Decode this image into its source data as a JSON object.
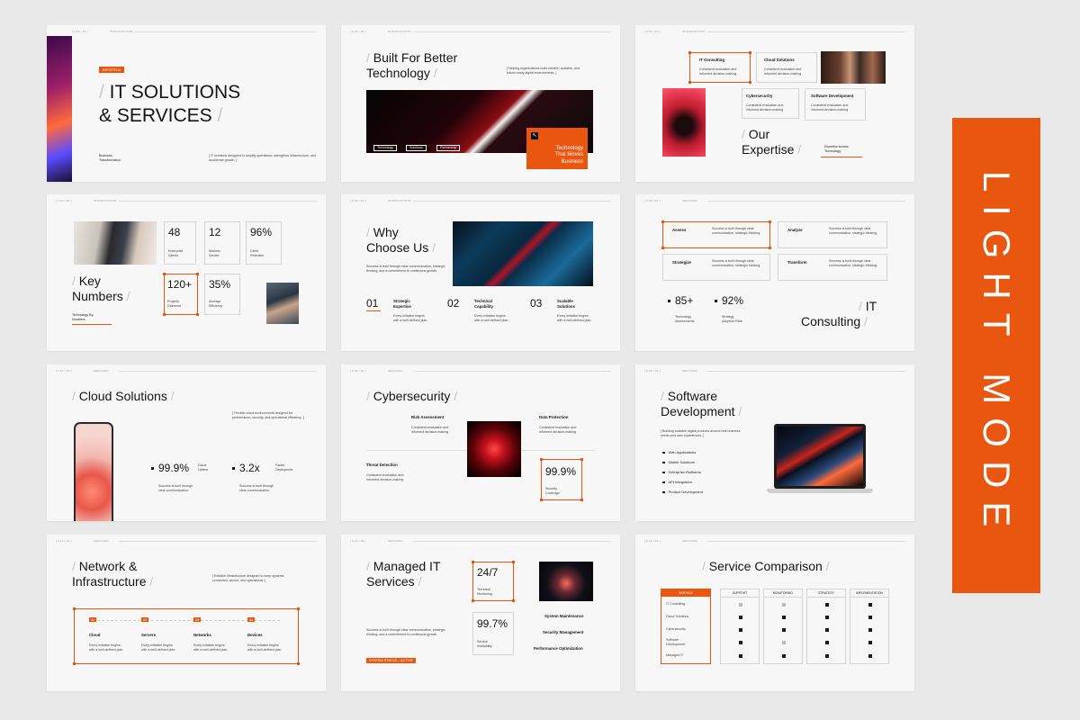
{
  "light_mode_label": "LIGHT MODE",
  "colors": {
    "accent": "#e8560f",
    "background": "#e9e9e9",
    "slide": "#f7f7f7",
    "text": "#141414"
  },
  "slides": {
    "s1": {
      "num": "[ 0.01 / 20 ]",
      "section": "INTRODUCTION",
      "badge": "INFOTECH",
      "title1": "IT SOLUTIONS",
      "title2": "& SERVICES",
      "sub_label": "Business\nTransformation",
      "desc": "[ IT solutions designed to amplify operations, strengthen infrastructure, and accelerate growth. ]"
    },
    "s2": {
      "num": "[ 0.02 / 20 ]",
      "section": "INTRODUCTION",
      "title1": "Built For Better",
      "title2": "Technology",
      "desc": "[ Helping organizations build reliable, scalable, and future-ready digital environments. ]",
      "tags": [
        "Technology",
        "Solutions",
        "Partnership"
      ],
      "overlay": "Technology\nThat Moves\nBusiness"
    },
    "s3": {
      "num": "[ 0.03 / 20 ]",
      "section": "INTRODUCTION",
      "cards": [
        {
          "label": "IT Consulting",
          "desc": "Consistent evaluation and informed decision-making"
        },
        {
          "label": "Cloud Solutions",
          "desc": "Consistent evaluation and informed decision-making"
        },
        {
          "label": "Cybersecurity",
          "desc": "Consistent evaluation and informed decision-making"
        },
        {
          "label": "Software Development",
          "desc": "Consistent evaluation and informed decision-making"
        }
      ],
      "title1": "Our",
      "title2": "Expertise",
      "tag": "Expertise Across\nTechnology"
    },
    "s4": {
      "num": "[ 0.04 / 20 ]",
      "section": "INTRODUCTION",
      "stats": [
        {
          "value": "48",
          "label": "Enterprise\nClients"
        },
        {
          "value": "12",
          "label": "Markets\nServed"
        },
        {
          "value": "96%",
          "label": "Client\nRetention"
        },
        {
          "value": "120+",
          "label": "Projects\nDelivered"
        },
        {
          "value": "35%",
          "label": "Average\nEfficiency"
        }
      ],
      "title1": "Key",
      "title2": "Numbers",
      "tag": "Technology By\nNumbers"
    },
    "s5": {
      "num": "[ 0.05 / 20 ]",
      "section": "INTRODUCTION",
      "title1": "Why",
      "title2": "Choose Us",
      "desc": "Success is built through clear communication, strategic thinking, and a commitment to continuous growth.",
      "items": [
        {
          "n": "01",
          "label": "Strategic\nExpertise",
          "desc": "Every initiative begins\nwith a well-defined plan."
        },
        {
          "n": "02",
          "label": "Technical\nCapability",
          "desc": "Every initiative begins\nwith a well-defined plan."
        },
        {
          "n": "03",
          "label": "Scalable\nSolutions",
          "desc": "Every initiative begins\nwith a well-defined plan."
        }
      ]
    },
    "s6": {
      "num": "[ 0.06 / 20 ]",
      "section": "SERVICES",
      "steps": [
        {
          "label": "Assess",
          "desc": "Success is built through clear communication, strategic thinking."
        },
        {
          "label": "Analyze",
          "desc": "Success is built through clear communication, strategic thinking."
        },
        {
          "label": "Strategize",
          "desc": "Success is built through clear communication, strategic thinking."
        },
        {
          "label": "Transform",
          "desc": "Success is built through clear communication, strategic thinking."
        }
      ],
      "stats": [
        {
          "value": "85+",
          "label": "Technology\nAssessments"
        },
        {
          "value": "92%",
          "label": "Strategy\nAdoption Rate"
        }
      ],
      "title1": "IT",
      "title2": "Consulting"
    },
    "s7": {
      "num": "[ 0.07 / 20 ]",
      "section": "SERVICES",
      "title": "Cloud Solutions",
      "desc": "[ Flexible cloud environments designed for performance, security, and operational efficiency. ]",
      "stats": [
        {
          "value": "99.9%",
          "label": "Cloud\nUptime",
          "desc": "Success is built through\nclear communication."
        },
        {
          "value": "3.2x",
          "label": "Faster\nDeployment",
          "desc": "Success is built through\nclear communication."
        }
      ]
    },
    "s8": {
      "num": "[ 0.08 / 20 ]",
      "section": "SERVICES",
      "title": "Cybersecurity",
      "items": [
        {
          "label": "Risk Assessment",
          "desc": "Consistent evaluation and\ninformed decision-making"
        },
        {
          "label": "Data Protection",
          "desc": "Consistent evaluation and\ninformed decision-making"
        },
        {
          "label": "Threat Detection",
          "desc": "Consistent evaluation and\ninformed decision-making"
        }
      ],
      "stat_value": "99.9%",
      "stat_label": "Security\nCoverage"
    },
    "s9": {
      "num": "[ 0.09 / 20 ]",
      "section": "SERVICES",
      "title1": "Software",
      "title2": "Development",
      "desc": "[ Building scalable digital products around real business needs and user experiences. ]",
      "list": [
        "Web Applications",
        "Mobile Solutions",
        "Enterprise Platforms",
        "API Integration",
        "Product Development"
      ]
    },
    "s10": {
      "num": "[ 0.10 / 20 ]",
      "section": "SERVICES",
      "title1": "Network &",
      "title2": "Infrastructure",
      "desc": "[ Reliable infrastructure designed to keep systems connected, secure, and operational. ]",
      "items": [
        {
          "n": "01",
          "label": "Cloud",
          "desc": "Every initiative begins\nwith a well-defined plan."
        },
        {
          "n": "02",
          "label": "Servers",
          "desc": "Every initiative begins\nwith a well-defined plan."
        },
        {
          "n": "03",
          "label": "Networks",
          "desc": "Every initiative begins\nwith a well-defined plan."
        },
        {
          "n": "04",
          "label": "Devices",
          "desc": "Every initiative begins\nwith a well-defined plan."
        }
      ]
    },
    "s11": {
      "num": "[ 0.11 / 20 ]",
      "section": "SERVICES",
      "title1": "Managed IT",
      "title2": "Services",
      "desc": "Success is built through clear communication, strategic thinking, and a commitment to continuous growth.",
      "status": "SYSTEM STATUS – ACTIVE",
      "stats": [
        {
          "value": "24/7",
          "label": "Technical\nMonitoring"
        },
        {
          "value": "99.7%",
          "label": "Service\nAvailability"
        }
      ],
      "list": [
        "System Maintenance",
        "Security Management",
        "Performance Optimization"
      ]
    },
    "s12": {
      "num": "[ 0.12 / 20 ]",
      "section": "SERVICES",
      "title": "Service Comparison",
      "header_label": "SERVICE",
      "columns": [
        "SUPPORT",
        "MONITORING",
        "STRATEGY",
        "IMPLEMENTATION"
      ],
      "rows": [
        "IT Consulting",
        "Cloud Solutions",
        "Cybersecurity",
        "Software\nDevelopment",
        "Managed IT"
      ]
    }
  }
}
